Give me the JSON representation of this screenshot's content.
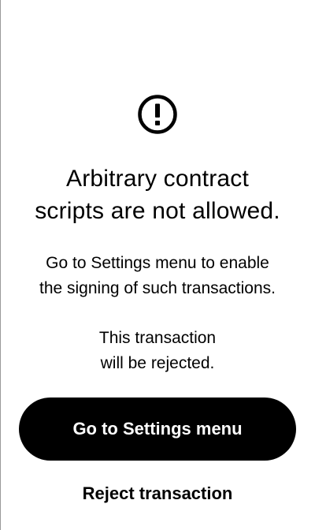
{
  "warning": {
    "icon": "exclamation-circle-icon",
    "title_lines": [
      "Arbitrary contract",
      "scripts are not allowed."
    ],
    "description_lines": [
      "Go to Settings menu to enable",
      "the signing of such transactions."
    ],
    "notice_lines": [
      "This transaction",
      "will be rejected."
    ]
  },
  "actions": {
    "settings_label": "Go to Settings menu",
    "reject_label": "Reject transaction"
  },
  "colors": {
    "background": "#ffffff",
    "text": "#000000",
    "button_background": "#000000",
    "button_text": "#ffffff"
  }
}
